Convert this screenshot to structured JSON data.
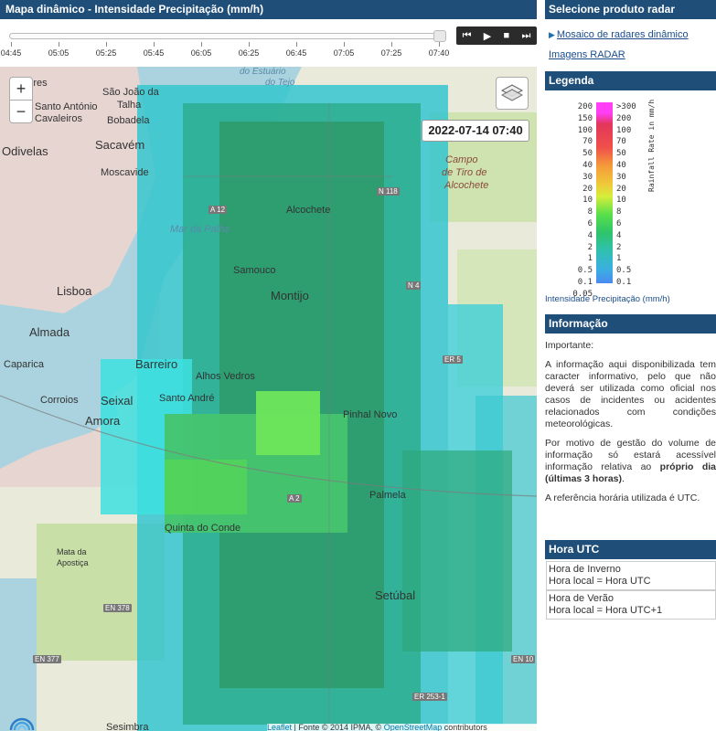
{
  "map_header": {
    "title": "Mapa dinâmico - Intensidade Precipitação (mm/h)"
  },
  "timeline": {
    "labels": [
      "04:45",
      "05:05",
      "05:25",
      "05:45",
      "06:05",
      "06:25",
      "06:45",
      "07:05",
      "07:25",
      "07:40"
    ],
    "controls": {
      "prev": "⏮",
      "play": "▶",
      "stop": "■",
      "next": "⏭"
    }
  },
  "map": {
    "timestamp": "2022-07-14 07:40",
    "zoom_in": "+",
    "zoom_out": "−",
    "attribution": {
      "leaflet": "Leaflet",
      "source": " | Fonte © 2014 IPMA, © ",
      "osm": "OpenStreetMap",
      "contributors": " contributors"
    },
    "places": {
      "loures": "Loures",
      "sao_joao": "São João da",
      "talha": "Talha",
      "santo_antonio": "Santo António",
      "cavaleiros": "Cavaleiros",
      "bobadela": "Bobadela",
      "odivelas": "Odivelas",
      "sacavem": "Sacavém",
      "moscavide": "Moscavide",
      "lisboa": "Lisboa",
      "almada": "Almada",
      "caparica": "Caparica",
      "corroios": "Corroios",
      "seixal": "Seixal",
      "amora": "Amora",
      "barreiro": "Barreiro",
      "alhos_vedros": "Alhos Vedros",
      "santo_andre": "Santo André",
      "samouco": "Samouco",
      "alcochete": "Alcochete",
      "montijo": "Montijo",
      "pinhal_novo": "Pinhal Novo",
      "palmela": "Palmela",
      "quinta_do_conde": "Quinta do Conde",
      "mata": "Mata da",
      "apostica": "Apostiça",
      "setubal": "Setúbal",
      "sesimbra": "Sesimbra",
      "campo": "Campo",
      "tiro": "de Tiro de",
      "alcochete2": "Alcochete",
      "mar_palha": "Mar da Palha",
      "estuario": "do Estuário",
      "tejo": "do Tejo"
    },
    "roads": {
      "a12": "A 12",
      "n118": "N 118",
      "n4": "N 4",
      "er5": "ER 5",
      "a2": "A 2",
      "en378": "EN 378",
      "en377": "EN 377",
      "er253": "ER 253-1",
      "en10": "EN 10"
    }
  },
  "sidebar": {
    "radar_header": "Selecione produto radar",
    "radar_links": [
      "Mosaico de radares dinâmico",
      "Imagens RADAR"
    ],
    "legend_header": "Legenda",
    "legend": {
      "left_labels": [
        "200",
        "150",
        "100",
        "70",
        "50",
        "40",
        "30",
        "20",
        "10",
        "8",
        "6",
        "4",
        "2",
        "1",
        "0.5",
        "0.1",
        "0.05"
      ],
      "right_labels": [
        ">300",
        "200",
        "100",
        "70",
        "50",
        "40",
        "30",
        "20",
        "10",
        "8",
        "6",
        "4",
        "2",
        "1",
        "0.5",
        "0.1"
      ],
      "axis": "Rainfall Rate in mm/h",
      "caption": "Intensidade Precipitação (mm/h)"
    },
    "info_header": "Informação",
    "info": {
      "important": "Importante",
      "p1": "A informação aqui disponibilizada tem caracter informativo, pelo que não deverá ser utilizada como oficial nos casos de incidentes ou acidentes relacionados com condições meteorológicas.",
      "p2a": "Por motivo de gestão do volume de informação só estará acessível informação relativa ao ",
      "p2b": "próprio dia (últimas 3 horas)",
      "p2c": ".",
      "p3": "A referência horária utilizada é UTC."
    },
    "utc_header": "Hora UTC",
    "utc": {
      "winter_title": "Hora de Inverno",
      "winter_value": "Hora local = Hora UTC",
      "summer_title": "Hora de Verão",
      "summer_value": "Hora local = Hora UTC+1"
    }
  },
  "colors": {
    "header_bg": "#1f4e79",
    "link": "#1a4c8b"
  }
}
